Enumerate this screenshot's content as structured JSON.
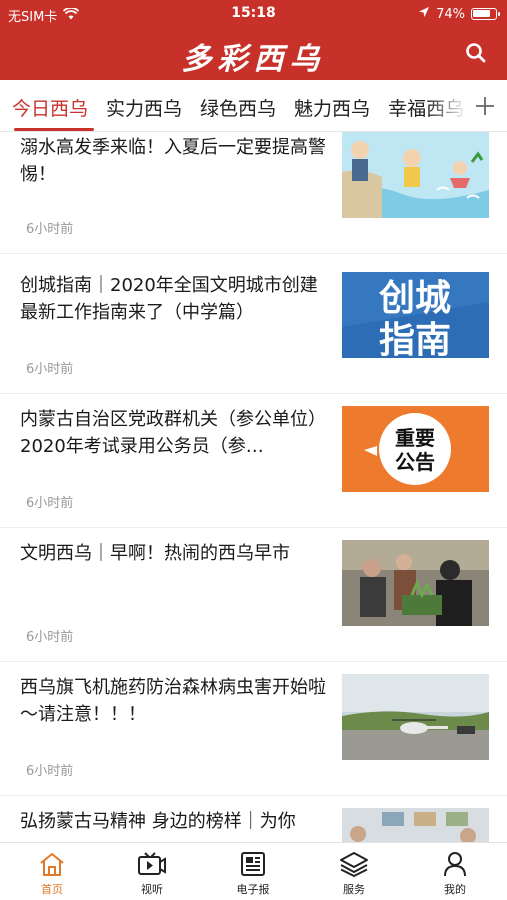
{
  "status_bar": {
    "carrier": "无SIM卡",
    "time": "15:18",
    "battery": "74%"
  },
  "header": {
    "title": "多彩西乌"
  },
  "tabs": [
    {
      "label": "今日西乌",
      "active": true
    },
    {
      "label": "实力西乌",
      "active": false
    },
    {
      "label": "绿色西乌",
      "active": false
    },
    {
      "label": "魅力西乌",
      "active": false
    },
    {
      "label": "幸福西乌",
      "active": false
    }
  ],
  "news": [
    {
      "title": "溺水高发季来临！入夏后一定要提高警惕！",
      "time": "6小时前",
      "thumb": "cartoon-drowning-image"
    },
    {
      "title": "创城指南｜2020年全国文明城市创建最新工作指南来了（中学篇）",
      "time": "6小时前",
      "thumb": "chuangcheng-zhinan-image",
      "thumb_text": [
        "创城",
        "指南"
      ]
    },
    {
      "title": "内蒙古自治区党政群机关（参公单位）2020年考试录用公务员（参…",
      "time": "6小时前",
      "thumb": "important-notice-image",
      "thumb_text": [
        "重要",
        "公告"
      ]
    },
    {
      "title": "文明西乌｜早啊！热闹的西乌早市",
      "time": "6小时前",
      "thumb": "morning-market-photo"
    },
    {
      "title": "西乌旗飞机施药防治森林病虫害开始啦～请注意！！！",
      "time": "6小时前",
      "thumb": "helicopter-photo"
    },
    {
      "title": "弘扬蒙古马精神 身边的榜样｜为你",
      "time": "",
      "thumb": "people-photo"
    }
  ],
  "tabbar": [
    {
      "label": "首页",
      "icon": "home-icon",
      "active": true
    },
    {
      "label": "视听",
      "icon": "video-icon",
      "active": false
    },
    {
      "label": "电子报",
      "icon": "newspaper-icon",
      "active": false
    },
    {
      "label": "服务",
      "icon": "layers-icon",
      "active": false
    },
    {
      "label": "我的",
      "icon": "user-icon",
      "active": false
    }
  ],
  "colors": {
    "brand": "#c8312a",
    "tab_active": "#e07a2a"
  }
}
